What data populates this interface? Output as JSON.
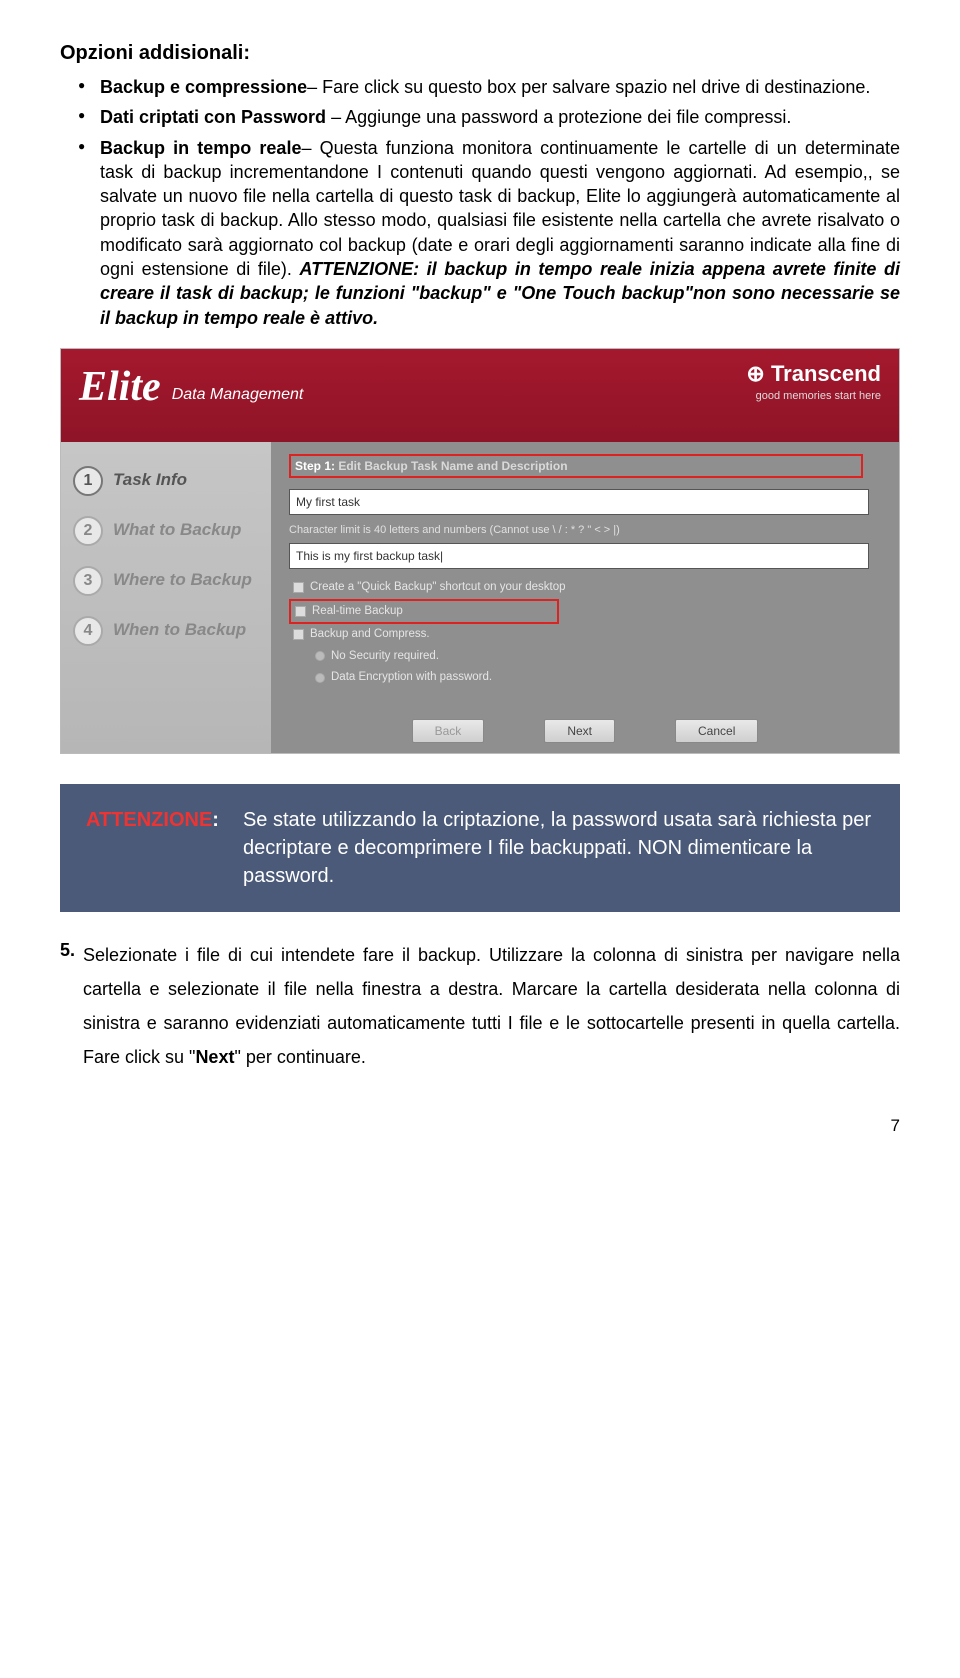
{
  "heading": "Opzioni addisionali:",
  "bullet1_label": "Backup e compressione",
  "bullet1_text": "– Fare click su questo box per salvare spazio nel drive di destinazione.",
  "bullet2_label": "Dati criptati con Password",
  "bullet2_text": " – Aggiunge una password a protezione dei file compressi.",
  "bullet3_label": "Backup in tempo reale",
  "bullet3_text": "– Questa funziona monitora continuamente le cartelle di un determinate task di backup incrementandone I contenuti quando questi vengono aggiornati. Ad esempio,, se salvate un nuovo file nella cartella di questo task di backup, Elite lo aggiungerà automaticamente al proprio task di backup. Allo stesso modo, qualsiasi file esistente nella cartella che avrete risalvato o modificato sarà aggiornato col backup (date e orari degli aggiornamenti saranno indicate alla fine di ogni estensione di file). ",
  "bullet3_emph": "ATTENZIONE: il backup in tempo reale inizia appena avrete finite di creare il task di backup; le funzioni \"backup\" e \"One Touch backup\"non sono necessarie se il backup in tempo reale è attivo.",
  "app": {
    "elite": "Elite",
    "elite_sub": "Data Management",
    "brand": "Transcend",
    "brand_tag": "good memories start here",
    "side1": "Task Info",
    "side2": "What to Backup",
    "side3": "Where to Backup",
    "side4": "When to Backup",
    "step_label": "Step 1:",
    "step_sub": " Edit Backup Task Name and Description",
    "name_val": "My first task",
    "char_hint": "Character limit is 40 letters and numbers (Cannot use \\ / : * ? \" < > |)",
    "desc_val": "This is my first backup task|",
    "opt_quick": "Create a \"Quick Backup\" shortcut on your desktop",
    "opt_realtime": "Real-time Backup",
    "opt_compress": "Backup and Compress.",
    "opt_nosec": "No Security required.",
    "opt_enc": "Data Encryption with password.",
    "btn_back": "Back",
    "btn_next": "Next",
    "btn_cancel": "Cancel"
  },
  "notice_label": "ATTENZIONE",
  "notice_colon": ":",
  "notice_text": "Se state utilizzando la criptazione, la password usata sarà richiesta per decriptare e decomprimere I file backuppati. NON dimenticare la password.",
  "step5_num": "5.",
  "step5_text_a": "Selezionate i file di cui intendete fare il backup. Utilizzare la colonna di sinistra per navigare nella cartella e selezionate il file nella finestra a destra. Marcare la cartella desiderata nella colonna di sinistra e saranno evidenziati automaticamente tutti I file e le sottocartelle presenti in quella cartella. Fare click su \"",
  "step5_next": "Next",
  "step5_text_b": "\" per continuare.",
  "page_number": "7"
}
